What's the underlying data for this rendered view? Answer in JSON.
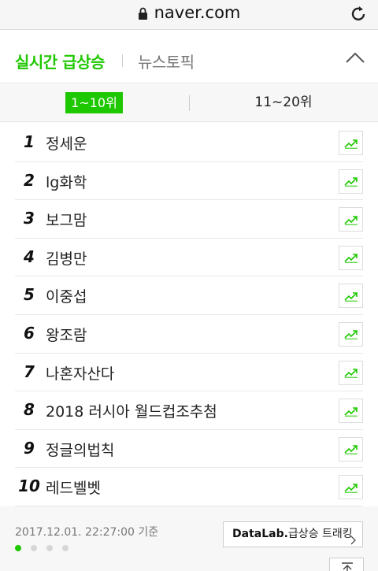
{
  "browser": {
    "url": "naver.com"
  },
  "tabs": {
    "active": "실시간 급상승",
    "other": "뉴스토픽"
  },
  "range": {
    "active": "1~10위",
    "other": "11~20위"
  },
  "items": [
    {
      "rank": "1",
      "term": "정세운"
    },
    {
      "rank": "2",
      "term": "lg화학"
    },
    {
      "rank": "3",
      "term": "보그맘"
    },
    {
      "rank": "4",
      "term": "김병만"
    },
    {
      "rank": "5",
      "term": "이중섭"
    },
    {
      "rank": "6",
      "term": "왕조람"
    },
    {
      "rank": "7",
      "term": "나혼자산다"
    },
    {
      "rank": "8",
      "term": "2018 러시아 월드컵조추첨"
    },
    {
      "rank": "9",
      "term": "정글의법칙"
    },
    {
      "rank": "10",
      "term": "레드벨벳"
    }
  ],
  "footer": {
    "timestamp": "2017.12.01. 22:27:00 기준",
    "datalab_brand": "DataLab.",
    "datalab_text": "급상승 트래킹",
    "dots_total": 4,
    "dots_active": 1
  },
  "colors": {
    "accent": "#1ec800"
  }
}
